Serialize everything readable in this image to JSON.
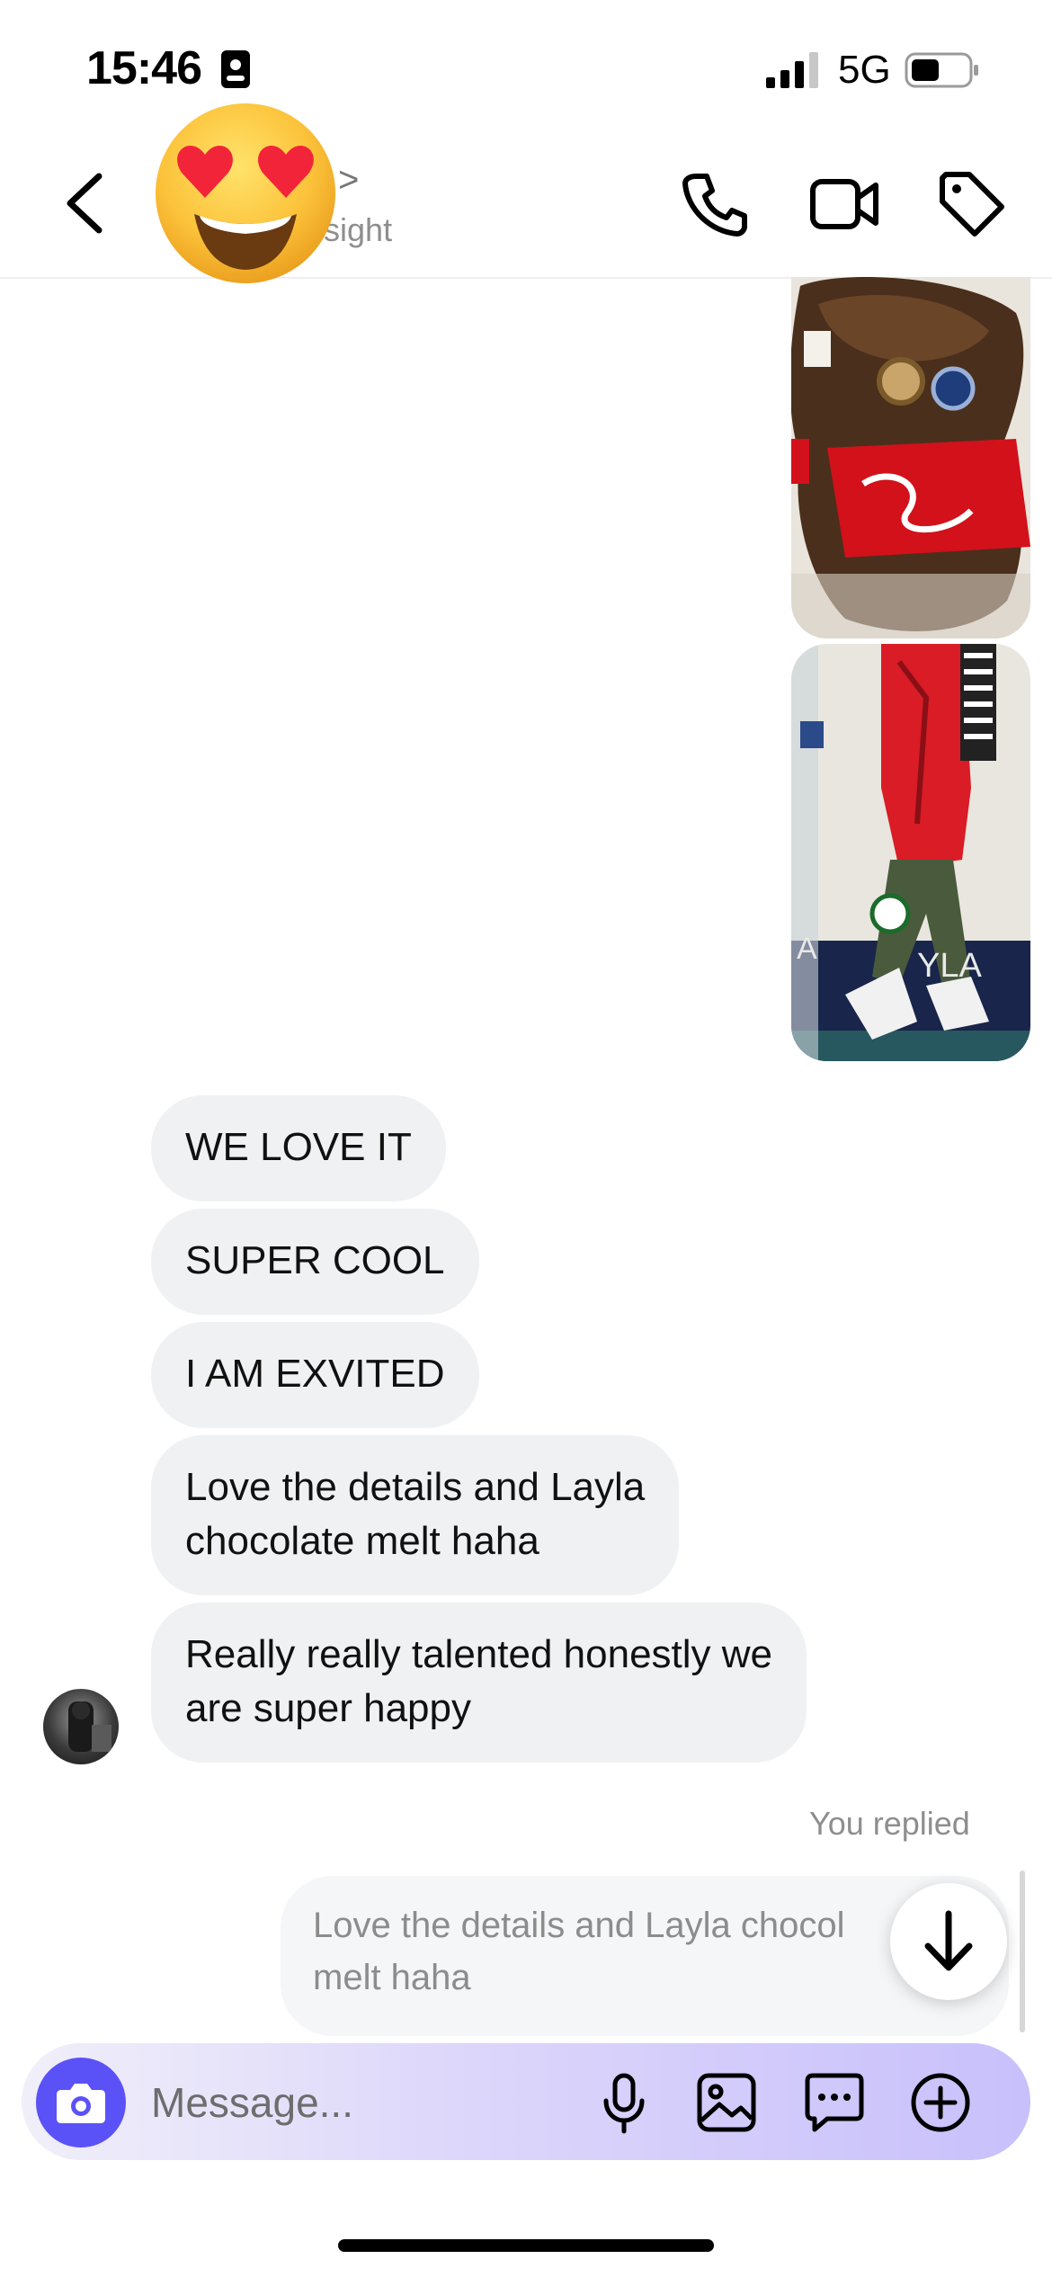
{
  "status_bar": {
    "time": "15:46",
    "network": "5G"
  },
  "header": {
    "subtitle_fragment": "nsight",
    "chevron": ">"
  },
  "messages": {
    "received": [
      {
        "text": "WE LOVE IT"
      },
      {
        "text": "SUPER COOL"
      },
      {
        "text": "I AM EXVITED"
      },
      {
        "text": "Love the details and Layla\nchocolate melt haha"
      },
      {
        "text": "Really really talented honestly we\nare super happy"
      }
    ],
    "reply_label": "You replied",
    "reply_quote": "Love the details and Layla chocol\nmelt haha"
  },
  "composer": {
    "placeholder": "Message..."
  },
  "icons": {
    "back": "chevron-left-icon",
    "call": "phone-icon",
    "video": "video-camera-icon",
    "tag": "tag-icon",
    "camera": "camera-icon",
    "mic": "microphone-icon",
    "gallery": "image-icon",
    "sticker": "chat-bubble-icon",
    "add": "plus-circle-icon",
    "scroll_down": "arrow-down-icon"
  },
  "colors": {
    "accent": "#5a52f7",
    "bubble": "#f0f1f3",
    "muted_text": "#8e8e8e"
  }
}
